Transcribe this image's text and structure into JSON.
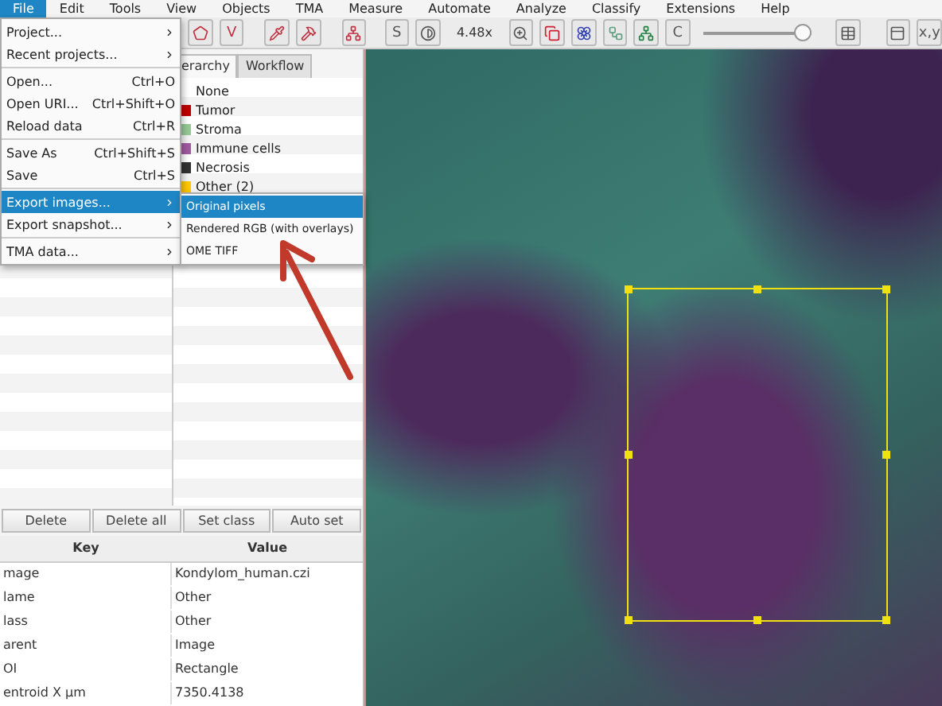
{
  "menubar": [
    {
      "label": "File",
      "selected": true
    },
    {
      "label": "Edit",
      "selected": false
    },
    {
      "label": "Tools",
      "selected": false
    },
    {
      "label": "View",
      "selected": false
    },
    {
      "label": "Objects",
      "selected": false
    },
    {
      "label": "TMA",
      "selected": false
    },
    {
      "label": "Measure",
      "selected": false
    },
    {
      "label": "Automate",
      "selected": false
    },
    {
      "label": "Analyze",
      "selected": false
    },
    {
      "label": "Classify",
      "selected": false
    },
    {
      "label": "Extensions",
      "selected": false
    },
    {
      "label": "Help",
      "selected": false
    }
  ],
  "toolbar": {
    "letters": [
      "V",
      "S",
      "C"
    ],
    "zoom": "4.48x",
    "slider": {
      "level": 1
    },
    "coords": "x,y"
  },
  "file_menu": [
    {
      "kind": "item",
      "label": "Project...",
      "submenu": true,
      "selected": false
    },
    {
      "kind": "item",
      "label": "Recent projects...",
      "submenu": true,
      "selected": false
    },
    {
      "kind": "separator"
    },
    {
      "kind": "item",
      "label": "Open...",
      "shortcut": "Ctrl+O",
      "submenu": false,
      "selected": false
    },
    {
      "kind": "item",
      "label": "Open URI...",
      "shortcut": "Ctrl+Shift+O",
      "submenu": false,
      "selected": false
    },
    {
      "kind": "item",
      "label": "Reload data",
      "shortcut": "Ctrl+R",
      "submenu": false,
      "selected": false
    },
    {
      "kind": "separator"
    },
    {
      "kind": "item",
      "label": "Save As",
      "shortcut": "Ctrl+Shift+S",
      "submenu": false,
      "selected": false
    },
    {
      "kind": "item",
      "label": "Save",
      "shortcut": "Ctrl+S",
      "submenu": false,
      "selected": false
    },
    {
      "kind": "separator"
    },
    {
      "kind": "item",
      "label": "Export images...",
      "submenu": true,
      "selected": true
    },
    {
      "kind": "item",
      "label": "Export snapshot...",
      "submenu": true,
      "selected": false
    },
    {
      "kind": "separator"
    },
    {
      "kind": "item",
      "label": "TMA data...",
      "submenu": true,
      "selected": false
    }
  ],
  "export_submenu": [
    {
      "label": "Original pixels",
      "selected": true
    },
    {
      "label": "Rendered RGB (with overlays)",
      "selected": false
    },
    {
      "label": "OME TIFF",
      "selected": false
    }
  ],
  "tabs": [
    {
      "label": "erarchy",
      "selected": true
    },
    {
      "label": "Workflow",
      "selected": false
    }
  ],
  "classes": [
    {
      "name": "None"
    },
    {
      "name": "Tumor",
      "color": "#c00000"
    },
    {
      "name": "Stroma",
      "color": "#96c896"
    },
    {
      "name": "Immune cells",
      "color": "#a05aa0"
    },
    {
      "name": "Necrosis",
      "color": "#323232"
    },
    {
      "name": "Other (2)",
      "color": "#ffc800"
    }
  ],
  "buttons": [
    "Delete",
    "Delete all",
    "Set class",
    "Auto set"
  ],
  "table": {
    "columns": [
      "Key",
      "Value"
    ],
    "rows": [
      [
        "mage",
        "Kondylom_human.czi"
      ],
      [
        "lame",
        "Other"
      ],
      [
        "lass",
        "Other"
      ],
      [
        "arent",
        "Image"
      ],
      [
        "OI",
        "Rectangle"
      ],
      [
        "entroid X µm",
        "7350.4138"
      ]
    ]
  }
}
